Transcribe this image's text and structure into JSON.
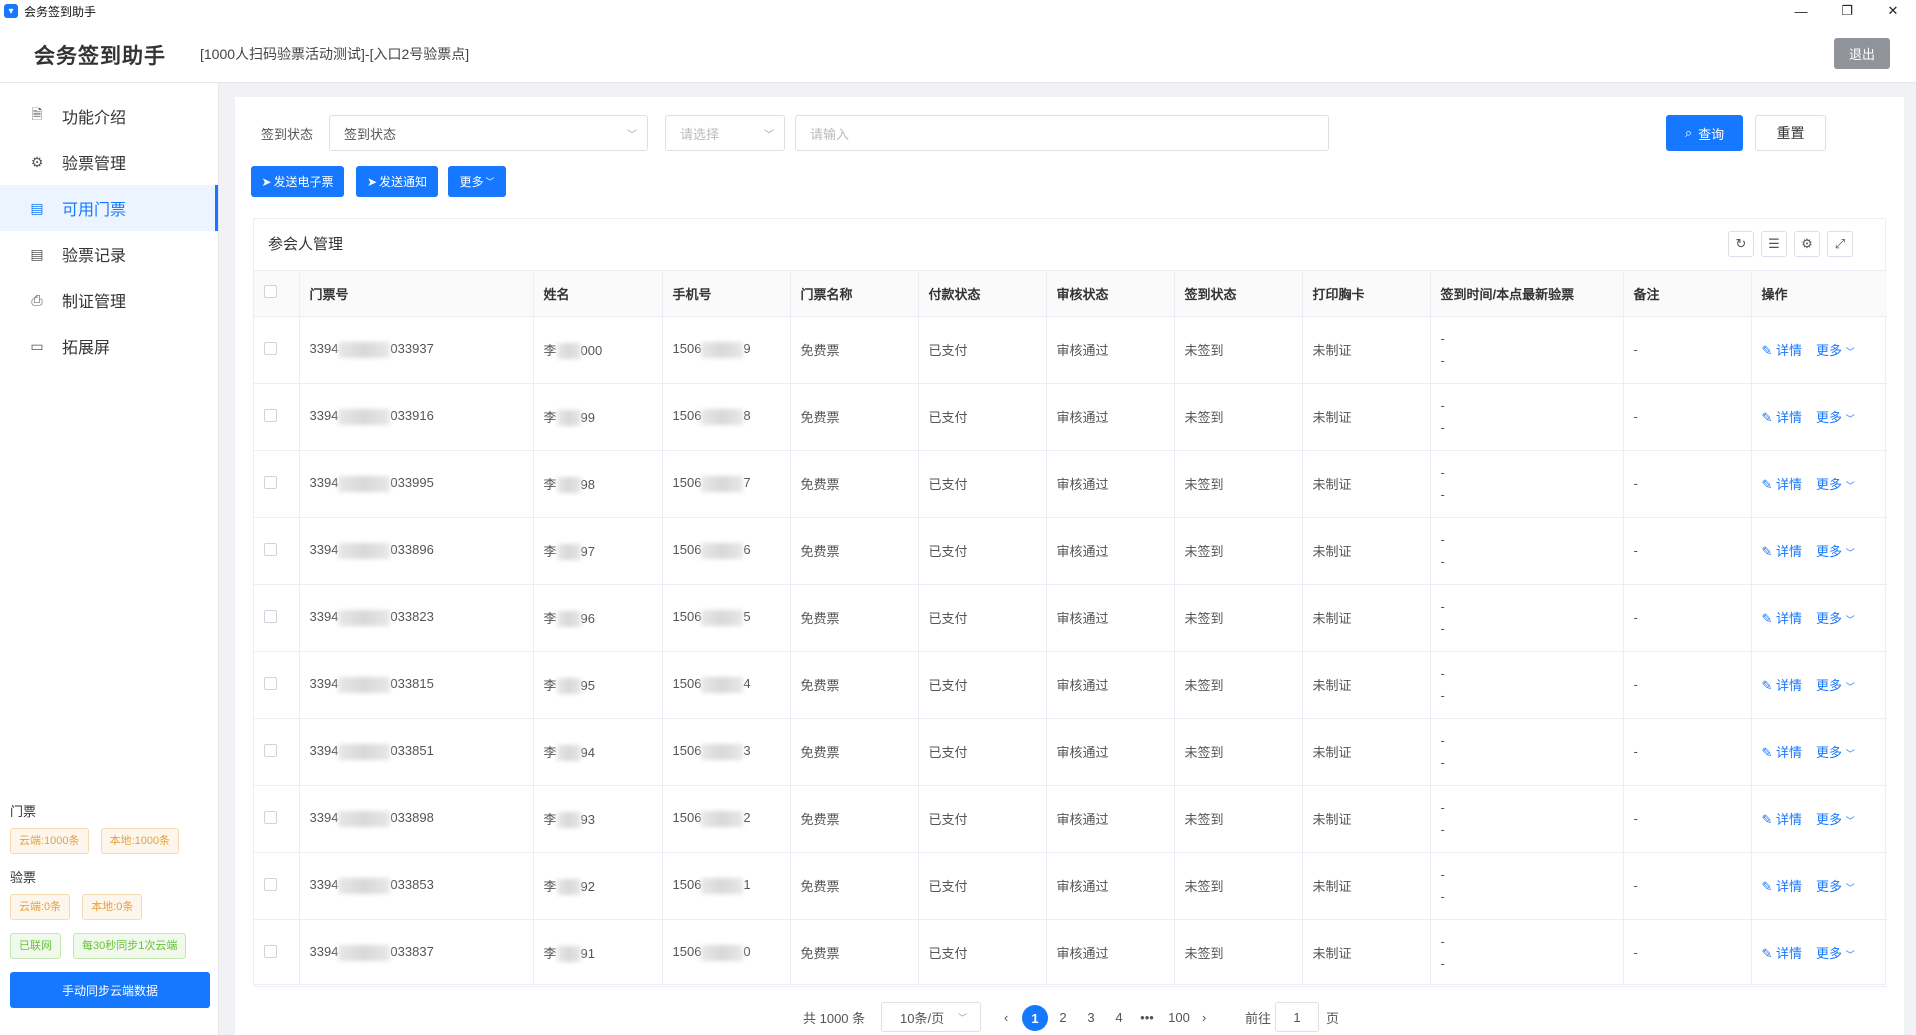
{
  "window": {
    "title": "会务签到助手",
    "controls": [
      "—",
      "❐",
      "✕"
    ]
  },
  "header": {
    "brand": "会务签到助手",
    "event": "[1000人扫码验票活动测试]-[入口2号验票点]",
    "logout_label": "退出"
  },
  "sidebar": {
    "items": [
      {
        "label": "功能介绍",
        "icon": "document-icon",
        "glyph": "🗎"
      },
      {
        "label": "验票管理",
        "icon": "gear-icon",
        "glyph": "⚙"
      },
      {
        "label": "可用门票",
        "icon": "list-icon",
        "glyph": "▤"
      },
      {
        "label": "验票记录",
        "icon": "record-icon",
        "glyph": "▤"
      },
      {
        "label": "制证管理",
        "icon": "printer-icon",
        "glyph": "⎙"
      },
      {
        "label": "拓展屏",
        "icon": "monitor-icon",
        "glyph": "▭"
      }
    ],
    "active_index": 2,
    "stats": {
      "ticket_title": "门票",
      "ticket_cloud": "云端:1000条",
      "ticket_local": "本地:1000条",
      "check_title": "验票",
      "check_cloud": "云端:0条",
      "check_local": "本地:0条",
      "network": "已联网",
      "sync_interval": "每30秒同步1次云端",
      "sync_button": "手动同步云端数据"
    }
  },
  "filter": {
    "label": "签到状态",
    "status_select": "签到状态",
    "field_select_placeholder": "请选择",
    "keyword_placeholder": "请输入",
    "query_label": "查询",
    "reset_label": "重置"
  },
  "actions": {
    "send_ticket": "发送电子票",
    "send_notice": "发送通知",
    "more": "更多"
  },
  "card": {
    "title": "参会人管理"
  },
  "table": {
    "columns": [
      "门票号",
      "姓名",
      "手机号",
      "门票名称",
      "付款状态",
      "审核状态",
      "签到状态",
      "打印胸卡",
      "签到时间/本点最新验票",
      "备注",
      "操作"
    ],
    "rows": [
      {
        "ticket_prefix": "3394",
        "ticket_suffix": "033937",
        "name_prefix": "李",
        "name_suffix": "000",
        "phone_prefix": "1506",
        "phone_suffix": "9",
        "ticket_name": "免费票",
        "pay": "已支付",
        "audit": "审核通过",
        "sign": "未签到",
        "print": "未制证",
        "time1": "-",
        "time2": "-",
        "remark": "-"
      },
      {
        "ticket_prefix": "3394",
        "ticket_suffix": "033916",
        "name_prefix": "李",
        "name_suffix": "99",
        "phone_prefix": "1506",
        "phone_suffix": "8",
        "ticket_name": "免费票",
        "pay": "已支付",
        "audit": "审核通过",
        "sign": "未签到",
        "print": "未制证",
        "time1": "-",
        "time2": "-",
        "remark": "-"
      },
      {
        "ticket_prefix": "3394",
        "ticket_suffix": "033995",
        "name_prefix": "李",
        "name_suffix": "98",
        "phone_prefix": "1506",
        "phone_suffix": "7",
        "ticket_name": "免费票",
        "pay": "已支付",
        "audit": "审核通过",
        "sign": "未签到",
        "print": "未制证",
        "time1": "-",
        "time2": "-",
        "remark": "-"
      },
      {
        "ticket_prefix": "3394",
        "ticket_suffix": "033896",
        "name_prefix": "李",
        "name_suffix": "97",
        "phone_prefix": "1506",
        "phone_suffix": "6",
        "ticket_name": "免费票",
        "pay": "已支付",
        "audit": "审核通过",
        "sign": "未签到",
        "print": "未制证",
        "time1": "-",
        "time2": "-",
        "remark": "-"
      },
      {
        "ticket_prefix": "3394",
        "ticket_suffix": "033823",
        "name_prefix": "李",
        "name_suffix": "96",
        "phone_prefix": "1506",
        "phone_suffix": "5",
        "ticket_name": "免费票",
        "pay": "已支付",
        "audit": "审核通过",
        "sign": "未签到",
        "print": "未制证",
        "time1": "-",
        "time2": "-",
        "remark": "-"
      },
      {
        "ticket_prefix": "3394",
        "ticket_suffix": "033815",
        "name_prefix": "李",
        "name_suffix": "95",
        "phone_prefix": "1506",
        "phone_suffix": "4",
        "ticket_name": "免费票",
        "pay": "已支付",
        "audit": "审核通过",
        "sign": "未签到",
        "print": "未制证",
        "time1": "-",
        "time2": "-",
        "remark": "-"
      },
      {
        "ticket_prefix": "3394",
        "ticket_suffix": "033851",
        "name_prefix": "李",
        "name_suffix": "94",
        "phone_prefix": "1506",
        "phone_suffix": "3",
        "ticket_name": "免费票",
        "pay": "已支付",
        "audit": "审核通过",
        "sign": "未签到",
        "print": "未制证",
        "time1": "-",
        "time2": "-",
        "remark": "-"
      },
      {
        "ticket_prefix": "3394",
        "ticket_suffix": "033898",
        "name_prefix": "李",
        "name_suffix": "93",
        "phone_prefix": "1506",
        "phone_suffix": "2",
        "ticket_name": "免费票",
        "pay": "已支付",
        "audit": "审核通过",
        "sign": "未签到",
        "print": "未制证",
        "time1": "-",
        "time2": "-",
        "remark": "-"
      },
      {
        "ticket_prefix": "3394",
        "ticket_suffix": "033853",
        "name_prefix": "李",
        "name_suffix": "92",
        "phone_prefix": "1506",
        "phone_suffix": "1",
        "ticket_name": "免费票",
        "pay": "已支付",
        "audit": "审核通过",
        "sign": "未签到",
        "print": "未制证",
        "time1": "-",
        "time2": "-",
        "remark": "-"
      },
      {
        "ticket_prefix": "3394",
        "ticket_suffix": "033837",
        "name_prefix": "李",
        "name_suffix": "91",
        "phone_prefix": "1506",
        "phone_suffix": "0",
        "ticket_name": "免费票",
        "pay": "已支付",
        "audit": "审核通过",
        "sign": "未签到",
        "print": "未制证",
        "time1": "-",
        "time2": "-",
        "remark": "-"
      }
    ],
    "detail_label": "详情",
    "more_label": "更多"
  },
  "pagination": {
    "total": "共 1000 条",
    "page_size": "10条/页",
    "pages": [
      "1",
      "2",
      "3",
      "4",
      "•••",
      "100"
    ],
    "current": "1",
    "goto_label": "前往",
    "goto_value": "1",
    "page_unit": "页"
  },
  "colors": {
    "primary": "#1677ff",
    "warning": "#e6a23c",
    "success": "#67c23a"
  }
}
